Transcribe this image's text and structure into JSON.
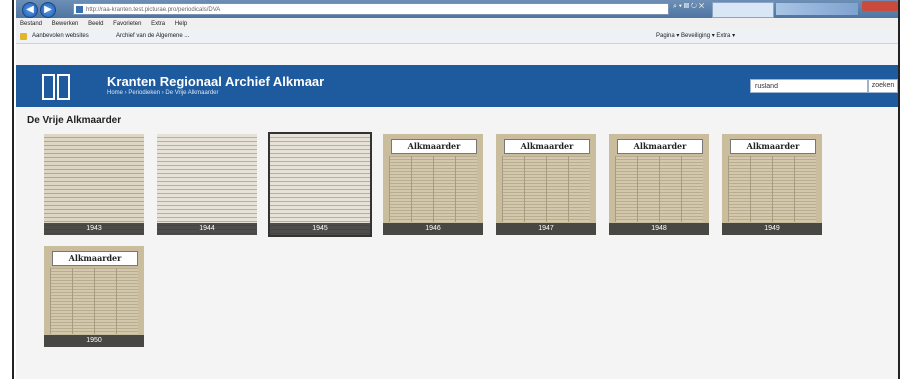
{
  "browser": {
    "url": "http://raa-kranten.test.picturae.pro/periodicals/DVA",
    "menu": [
      "Bestand",
      "Bewerken",
      "Beeld",
      "Favorieten",
      "Extra",
      "Help"
    ],
    "favorites": [
      "Aanbevolen websites",
      "Archief van de Algemene ..."
    ],
    "command_bar": "Pagina ▾ Beveiliging ▾ Extra ▾"
  },
  "site": {
    "title": "Kranten Regionaal Archief Alkmaar",
    "breadcrumb": "Home › Periodieken › De Vrije Alkmaarder",
    "search_value": "rusland",
    "search_button": "zoeken"
  },
  "page": {
    "heading": "De Vrije Alkmaarder",
    "masthead": "Alkmaarder",
    "years": [
      "1943",
      "1944",
      "1945",
      "1946",
      "1947",
      "1948",
      "1949",
      "1950"
    ]
  }
}
